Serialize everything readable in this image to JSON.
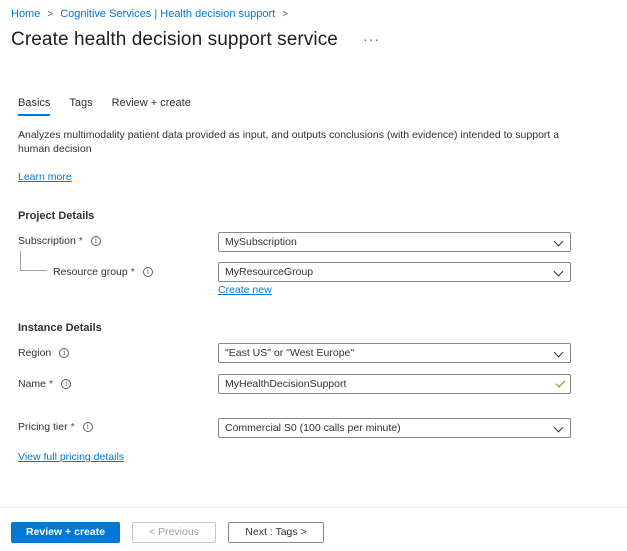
{
  "breadcrumb": {
    "items": [
      "Home",
      "Cognitive Services | Health decision support"
    ],
    "separator": ">"
  },
  "page": {
    "title": "Create health decision support service",
    "more": "···"
  },
  "tabs": [
    {
      "label": "Basics",
      "active": true
    },
    {
      "label": "Tags",
      "active": false
    },
    {
      "label": "Review + create",
      "active": false
    }
  ],
  "description": "Analyzes multimodality patient data provided as input, and outputs conclusions (with evidence) intended to support a human decision",
  "learn_more": "Learn more",
  "project": {
    "title": "Project Details",
    "subscription_label": "Subscription",
    "subscription_value": "MySubscription",
    "resource_group_label": "Resource group",
    "resource_group_value": "MyResourceGroup",
    "create_new": "Create new"
  },
  "instance": {
    "title": "Instance Details",
    "region_label": "Region",
    "region_value": "\"East US\" or \"West Europe\"",
    "name_label": "Name",
    "name_value": "MyHealthDecisionSupport",
    "pricing_label": "Pricing tier",
    "pricing_value": "Commercial S0 (100 calls per minute)",
    "pricing_link": "View full pricing details"
  },
  "required_marker": "*",
  "info_glyph": "i",
  "footer": {
    "review_create": "Review + create",
    "previous": "< Previous",
    "next": "Next : Tags >"
  },
  "colors": {
    "accent": "#0078d4",
    "required": "#a4262c",
    "valid": "#57a300"
  },
  "icons": {
    "chevron": "chevron-down-icon",
    "info": "info-icon",
    "check": "checkmark-icon"
  }
}
